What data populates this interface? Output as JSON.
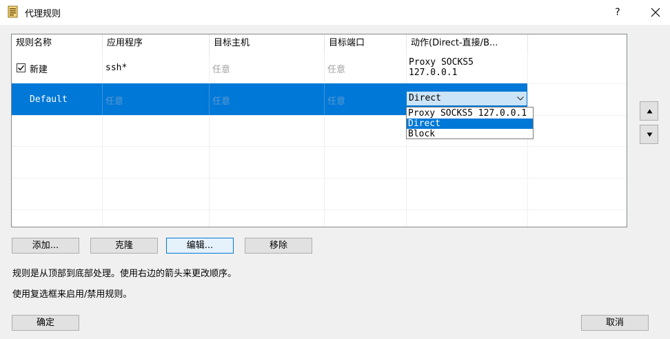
{
  "window": {
    "title": "代理规则",
    "help_label": "?"
  },
  "table": {
    "columns": [
      "规则名称",
      "应用程序",
      "目标主机",
      "目标端口",
      "动作(Direct-直接/B..."
    ],
    "rows": [
      {
        "checked": true,
        "name": "新建",
        "app": "ssh*",
        "host": "任意",
        "port": "任意",
        "action_line1": "Proxy SOCKS5",
        "action_line2": "127.0.0.1"
      },
      {
        "name": "Default",
        "app": "任意",
        "host": "任意",
        "port": "任意",
        "action": "Direct"
      }
    ]
  },
  "dropdown": {
    "options": [
      "Proxy SOCKS5 127.0.0.1",
      "Direct",
      "Block"
    ],
    "selected": "Direct"
  },
  "buttons": {
    "add": "添加...",
    "clone": "克隆",
    "edit": "编辑...",
    "remove": "移除",
    "ok": "确定",
    "cancel": "取消"
  },
  "info": {
    "line1": "规则是从顶部到底部处理。使用右边的箭头来更改顺序。",
    "line2": "使用复选框来启用/禁用规则。"
  },
  "icons": {
    "app": "rules-document-icon",
    "move_up": "triangle-up-icon",
    "move_down": "triangle-down-icon"
  },
  "colors": {
    "selection": "#0078d7",
    "background": "#f0f0f0"
  }
}
